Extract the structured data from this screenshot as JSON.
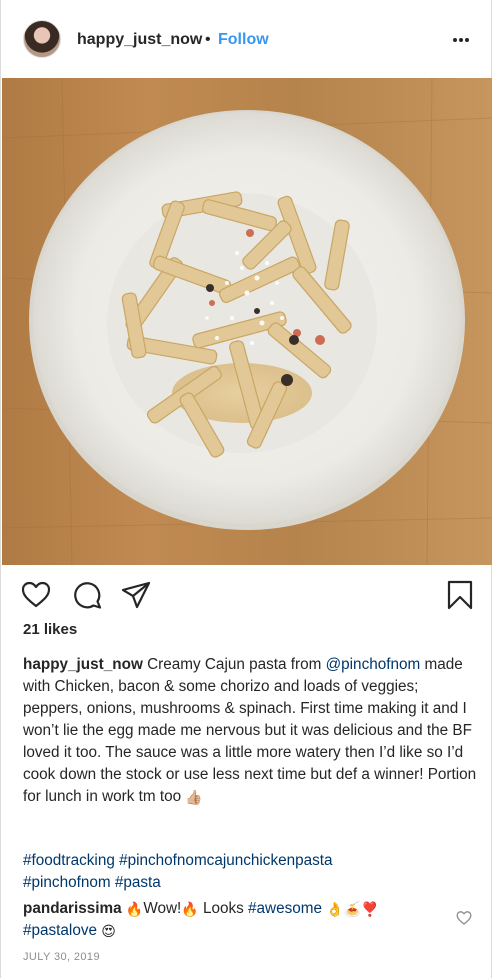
{
  "post": {
    "username": "happy_just_now",
    "separator": "•",
    "follow_label": "Follow",
    "more_icon": "more-options-icon",
    "photo_alt": "Creamy Cajun pasta in a white bowl on a wooden table",
    "likes": "21 likes",
    "caption": {
      "username": "happy_just_now",
      "text_before": "Creamy Cajun pasta from ",
      "mention": "@pinchofnom",
      "text_after": " made with Chicken, bacon & some chorizo and loads of veggies; peppers, onions, mushrooms & spinach. First time making it and I won’t lie the egg made me nervous but it was delicious and the BF loved it too. The sauce was a little more watery then I’d like so I’d cook down the stock or use less next time but def a winner! Portion for lunch in work tm too ",
      "emoji": "👍🏼"
    },
    "hashtags": {
      "line1": "#foodtracking #pinchofnomcajunchickenpasta",
      "line2": "#pinchofnom #pasta"
    },
    "comment": {
      "username": "pandarissima",
      "emoji_1": "🔥",
      "text_1": "Wow!",
      "emoji_2": "🔥",
      "text_2": " Looks ",
      "hashtag_1": "#awesome",
      "emoji_3": "👌🍝❣️",
      "hashtag_2": "#pastalove",
      "emoji_4": "😍"
    },
    "date": "JULY 30, 2019"
  },
  "colors": {
    "link_blue": "#3897f0",
    "hashtag_blue": "#00376b",
    "text": "#262626",
    "muted": "#8e8e8e",
    "wood": "#b8844d"
  },
  "icons": [
    "like-heart-icon",
    "comment-icon",
    "share-icon",
    "save-bookmark-icon",
    "comment-like-heart-icon"
  ]
}
